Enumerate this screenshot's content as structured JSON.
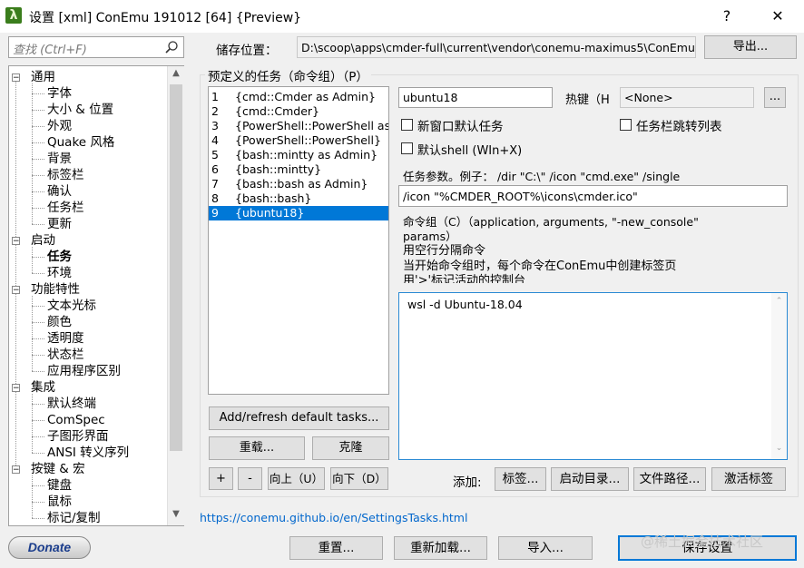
{
  "window": {
    "title": "设置 [xml] ConEmu 191012 [64] {Preview}",
    "help": "?",
    "close": "✕"
  },
  "header": {
    "search_placeholder": "查找 (Ctrl+F)",
    "storage_label": "储存位置：",
    "storage_path": "D:\\scoop\\apps\\cmder-full\\current\\vendor\\conemu-maximus5\\ConEmu.xml",
    "export_label": "导出..."
  },
  "tree": {
    "items": [
      {
        "label": "通用",
        "level": 0,
        "expander": "−"
      },
      {
        "label": "字体",
        "level": 1
      },
      {
        "label": "大小 & 位置",
        "level": 1
      },
      {
        "label": "外观",
        "level": 1
      },
      {
        "label": "Quake 风格",
        "level": 1
      },
      {
        "label": "背景",
        "level": 1
      },
      {
        "label": "标签栏",
        "level": 1
      },
      {
        "label": "确认",
        "level": 1
      },
      {
        "label": "任务栏",
        "level": 1
      },
      {
        "label": "更新",
        "level": 1
      },
      {
        "label": "启动",
        "level": 0,
        "expander": "−"
      },
      {
        "label": "任务",
        "level": 1,
        "selected": true
      },
      {
        "label": "环境",
        "level": 1
      },
      {
        "label": "功能特性",
        "level": 0,
        "expander": "−"
      },
      {
        "label": "文本光标",
        "level": 1
      },
      {
        "label": "颜色",
        "level": 1
      },
      {
        "label": "透明度",
        "level": 1
      },
      {
        "label": "状态栏",
        "level": 1
      },
      {
        "label": "应用程序区别",
        "level": 1
      },
      {
        "label": "集成",
        "level": 0,
        "expander": "−"
      },
      {
        "label": "默认终端",
        "level": 1
      },
      {
        "label": "ComSpec",
        "level": 1
      },
      {
        "label": "子图形界面",
        "level": 1
      },
      {
        "label": "ANSI 转义序列",
        "level": 1
      },
      {
        "label": "按键 & 宏",
        "level": 0,
        "expander": "−"
      },
      {
        "label": "键盘",
        "level": 1
      },
      {
        "label": "鼠标",
        "level": 1
      },
      {
        "label": "标记/复制",
        "level": 1
      }
    ]
  },
  "tasks": {
    "group_label": "预定义的任务（命令组）（P）",
    "items": [
      {
        "num": "1",
        "name": "{cmd::Cmder as Admin}"
      },
      {
        "num": "2",
        "name": "{cmd::Cmder}"
      },
      {
        "num": "3",
        "name": "{PowerShell::PowerShell as Admin}"
      },
      {
        "num": "4",
        "name": "{PowerShell::PowerShell}"
      },
      {
        "num": "5",
        "name": "{bash::mintty as Admin}"
      },
      {
        "num": "6",
        "name": "{bash::mintty}"
      },
      {
        "num": "7",
        "name": "{bash::bash as Admin}"
      },
      {
        "num": "8",
        "name": "{bash::bash}"
      },
      {
        "num": "9",
        "name": "{ubuntu18}",
        "selected": true
      }
    ],
    "add_refresh": "Add/refresh default tasks...",
    "reload": "重载...",
    "clone": "克隆",
    "plus": "+",
    "minus": "-",
    "up": "向上（U）",
    "down": "向下（D）"
  },
  "detail": {
    "task_name": "ubuntu18",
    "hotkey_label": "热键（H",
    "hotkey_value": "<None>",
    "hotkey_btn": "...",
    "new_window_default": "新窗口默认任务",
    "taskbar_jump": "任务栏跳转列表",
    "default_shell": "默认shell (WIn+X)",
    "params_label": "任务参数。例子： /dir \"C:\\\" /icon \"cmd.exe\" /single",
    "params_value": "/icon \"%CMDER_ROOT%\\icons\\cmder.ico\"",
    "cmd_label_1": "命令组（C）（application, arguments, \"-new_console\"",
    "cmd_label_2": "params）",
    "cmd_label_3": "用空行分隔命令",
    "cmd_label_4": "当开始命令组时，每个命令在ConEmu中创建标签页",
    "cmd_label_5": "用'>'标记活动的控制台",
    "commands": "wsl -d Ubuntu-18.04",
    "add_label": "添加:",
    "add_tab": "标签...",
    "add_startdir": "启动目录...",
    "add_filepath": "文件路径...",
    "add_activate": "激活标签"
  },
  "footer": {
    "link": "https://conemu.github.io/en/SettingsTasks.html",
    "donate": "Donate",
    "reset": "重置...",
    "reload": "重新加载...",
    "import": "导入...",
    "save": "保存设置",
    "watermark": "@稀土掘金技术社区"
  }
}
